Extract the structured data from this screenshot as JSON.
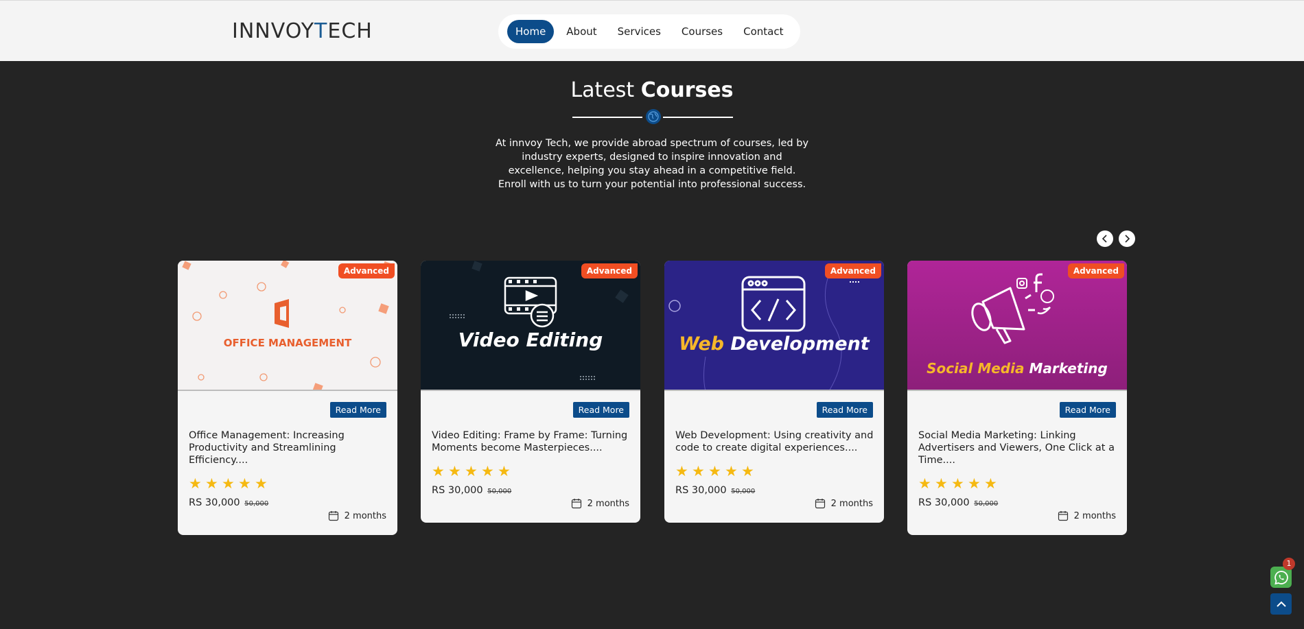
{
  "brand": {
    "logo_text_1": "INNVOY",
    "logo_text_accent": "T",
    "logo_text_2": "ECH"
  },
  "nav": {
    "items": [
      {
        "label": "Home",
        "active": true
      },
      {
        "label": "About"
      },
      {
        "label": "Services"
      },
      {
        "label": "Courses"
      },
      {
        "label": "Contact"
      }
    ]
  },
  "section": {
    "title_light": "Latest ",
    "title_bold": "Courses",
    "intro": "At innvoy Tech, we provide abroad spectrum of courses, led by industry experts, designed to inspire innovation and excellence, helping you stay ahead in a competitive field. Enroll with us to turn your potential into professional success."
  },
  "carousel": {
    "prev_icon": "chevron-left-icon",
    "next_icon": "chevron-right-icon"
  },
  "courses": [
    {
      "badge": "Advanced",
      "image_text": "OFFICE MANAGEMENT",
      "read_more": "Read More",
      "title": "Office Management: Increasing Productivity and Streamlining Efficiency....",
      "rating": 5,
      "price": "RS 30,000",
      "old_price": "50,000",
      "duration": "2 months"
    },
    {
      "badge": "Advanced",
      "image_text": "Video Editing",
      "read_more": "Read More",
      "title": "Video Editing: Frame by Frame: Turning Moments become Masterpieces....",
      "rating": 5,
      "price": "RS 30,000",
      "old_price": "50,000",
      "duration": "2 months"
    },
    {
      "badge": "Advanced",
      "image_text_1": "Web",
      "image_text_2": "Development",
      "read_more": "Read More",
      "title": "Web Development: Using creativity and code to create digital experiences....",
      "rating": 5,
      "price": "RS 30,000",
      "old_price": "50,000",
      "duration": "2 months"
    },
    {
      "badge": "Advanced",
      "image_text_1": "Social Media",
      "image_text_2": "Marketing",
      "read_more": "Read More",
      "title": "Social Media Marketing: Linking Advertisers and Viewers, One Click at a Time....",
      "rating": 5,
      "price": "RS 30,000",
      "old_price": "50,000",
      "duration": "2 months"
    }
  ],
  "floating": {
    "whatsapp_count": "1"
  },
  "colors": {
    "primary": "#0c4c8a",
    "badge": "#f04e23",
    "star": "#f5b912",
    "bg": "#242424"
  }
}
